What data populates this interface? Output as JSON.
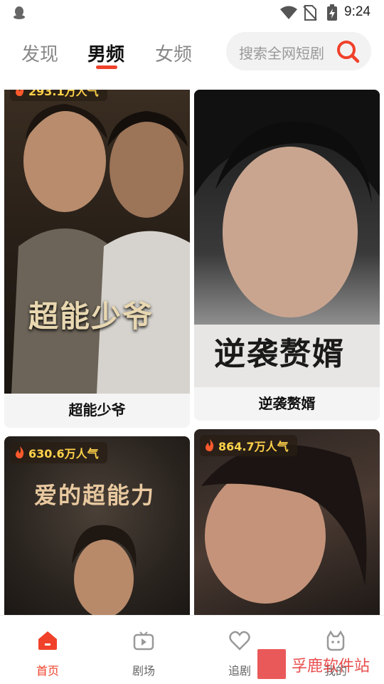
{
  "status_bar": {
    "time": "9:24",
    "icons": [
      "qq-icon",
      "wifi-icon",
      "no-sim-icon",
      "battery-charging-icon"
    ]
  },
  "top_tabs": [
    {
      "label": "发现",
      "active": false
    },
    {
      "label": "男频",
      "active": true
    },
    {
      "label": "女频",
      "active": false
    }
  ],
  "search": {
    "placeholder": "搜索全网短剧",
    "icon": "search-icon",
    "accent": "#f0412a"
  },
  "dramas": [
    {
      "title": "超能少爷",
      "poster_title": "超能少爷",
      "popularity": "293.1万人气"
    },
    {
      "title": "逆袭赘婿",
      "poster_title": "逆袭赘婿",
      "popularity": ""
    },
    {
      "title": "",
      "poster_title": "爱的超能力",
      "popularity": "630.6万人气"
    },
    {
      "title": "",
      "poster_title": "",
      "popularity": "864.7万人气"
    }
  ],
  "bottom_nav": [
    {
      "label": "首页",
      "icon": "home-icon",
      "active": true
    },
    {
      "label": "剧场",
      "icon": "tv-icon",
      "active": false
    },
    {
      "label": "追剧",
      "icon": "heart-icon",
      "active": false
    },
    {
      "label": "我的",
      "icon": "profile-icon",
      "active": false
    }
  ],
  "watermark": {
    "text": "孚鹿软件站"
  }
}
